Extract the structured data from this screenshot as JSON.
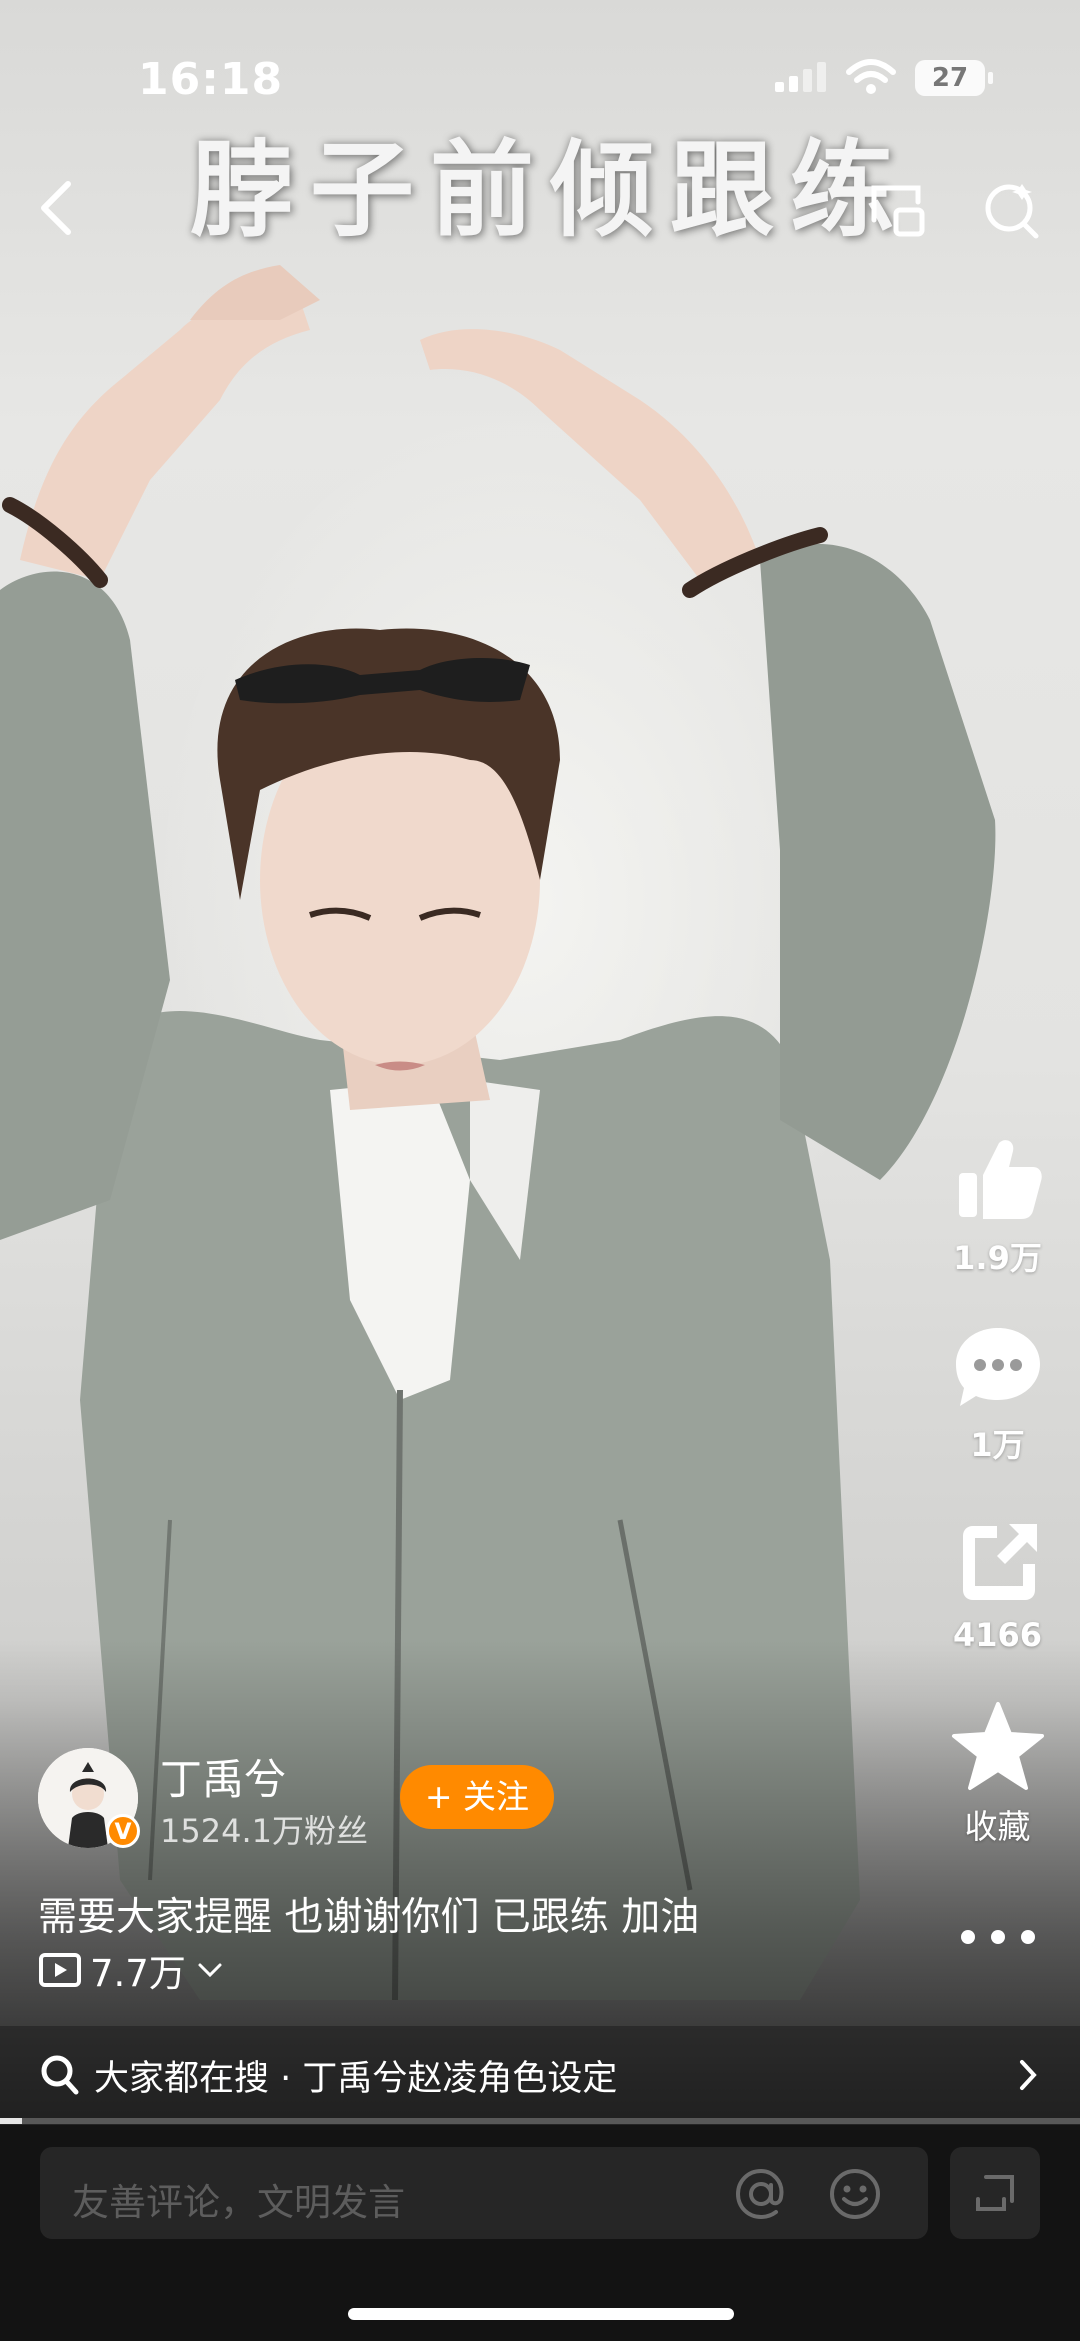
{
  "status_bar": {
    "time": "16:18",
    "battery": "27"
  },
  "video": {
    "overlay_title": "脖子前倾跟练"
  },
  "actions": {
    "like_count": "1.9万",
    "comment_count": "1万",
    "share_count": "4166",
    "favorite_label": "收藏"
  },
  "author": {
    "name": "丁禹兮",
    "fans": "1524.1万粉丝",
    "follow_label": "+ 关注",
    "verified_mark": "V"
  },
  "post": {
    "caption": "需要大家提醒 也谢谢你们 已跟练 加油",
    "views": "7.7万"
  },
  "search_strip": {
    "text": "大家都在搜 · 丁禹兮赵凌角色设定"
  },
  "comment_bar": {
    "placeholder": "友善评论，文明发言"
  },
  "colors": {
    "accent": "#ff8a00",
    "bottom_bg": "#131313"
  }
}
